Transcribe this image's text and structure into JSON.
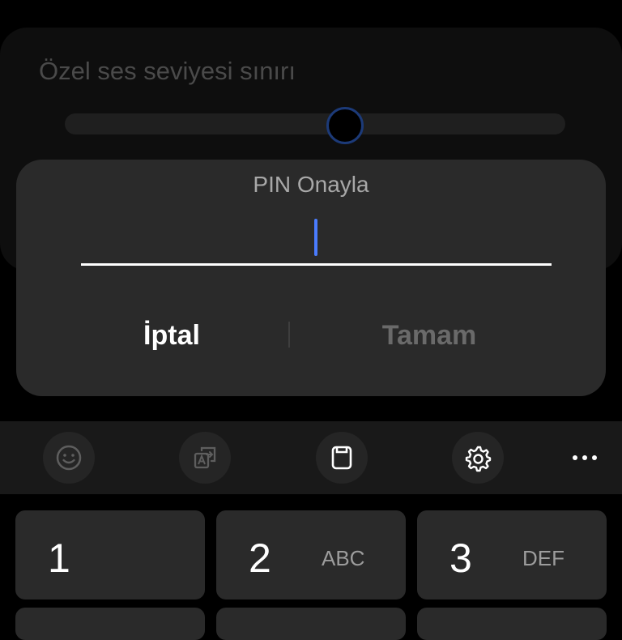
{
  "background_setting": {
    "title": "Özel ses seviyesi sınırı",
    "slider_value_fraction": 0.55
  },
  "dialog": {
    "title": "PIN Onayla",
    "pin_value": "",
    "cancel_label": "İptal",
    "ok_label": "Tamam"
  },
  "toolbar": {
    "items": [
      {
        "name": "emoji",
        "icon": "smiley-icon"
      },
      {
        "name": "translate",
        "icon": "translate-icon"
      },
      {
        "name": "clipboard",
        "icon": "clipboard-icon"
      },
      {
        "name": "settings",
        "icon": "gear-icon"
      },
      {
        "name": "more",
        "icon": "more-icon"
      }
    ]
  },
  "keypad": {
    "keys": [
      {
        "digit": "1",
        "letters": ""
      },
      {
        "digit": "2",
        "letters": "ABC"
      },
      {
        "digit": "3",
        "letters": "DEF"
      }
    ]
  },
  "colors": {
    "accent": "#4a7cff",
    "dialog_bg": "#2a2a2a",
    "key_bg": "#2a2a2a",
    "toolbar_bg": "#191919"
  }
}
